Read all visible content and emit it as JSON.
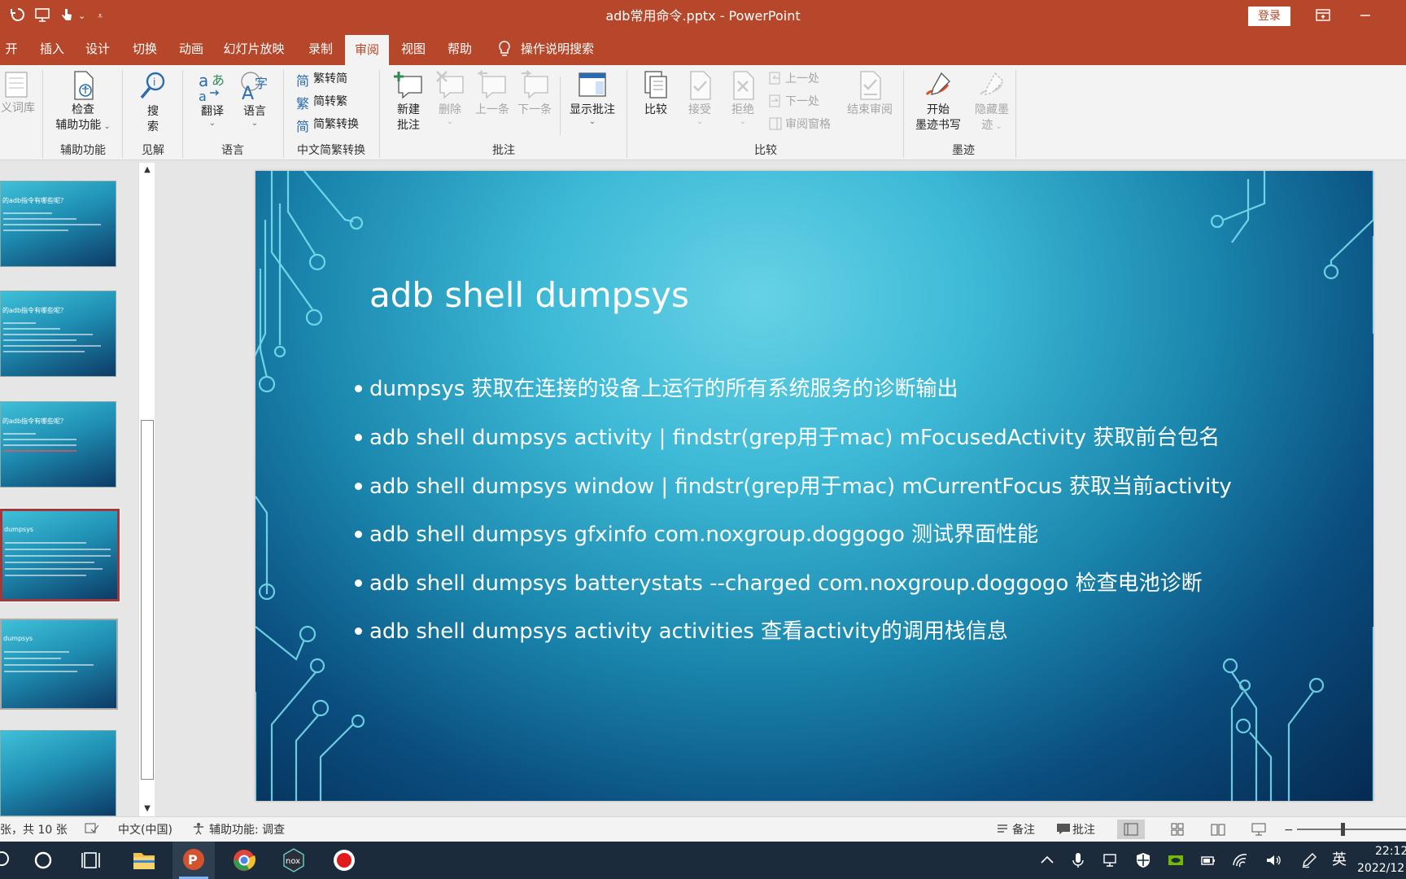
{
  "window": {
    "title": "adb常用命令.pptx  -  PowerPoint",
    "login_label": "登录"
  },
  "tabs": [
    {
      "label": "开始"
    },
    {
      "label": "插入"
    },
    {
      "label": "设计"
    },
    {
      "label": "切换"
    },
    {
      "label": "动画"
    },
    {
      "label": "幻灯片放映"
    },
    {
      "label": "录制"
    },
    {
      "label": "审阅",
      "active": true
    },
    {
      "label": "视图"
    },
    {
      "label": "帮助"
    }
  ],
  "tell_me": {
    "label": "操作说明搜索",
    "icon": "lightbulb-icon"
  },
  "ribbon": {
    "thesaurus_label": "义词库",
    "check_accessibility_line1": "检查",
    "check_accessibility_line2": "辅助功能",
    "group_accessibility": "辅助功能",
    "search_line1": "搜",
    "search_line2": "索",
    "group_insights": "见解",
    "translate_label": "翻译",
    "language_label": "语言",
    "group_language": "语言",
    "trad_to_simp": "繁转简",
    "simp_to_trad": "简转繁",
    "simp_trad_convert": "简繁转换",
    "group_chinese_convert": "中文简繁转换",
    "new_comment_line1": "新建",
    "new_comment_line2": "批注",
    "delete_label": "删除",
    "previous_label": "上一条",
    "next_label": "下一条",
    "show_comments_label": "显示批注",
    "group_comments": "批注",
    "compare_label": "比较",
    "accept_label": "接受",
    "reject_label": "拒绝",
    "prev_change": "上一处",
    "next_change": "下一处",
    "reviewing_pane": "审阅窗格",
    "end_review_label": "结束审阅",
    "group_compare": "比较",
    "start_inking_line1": "开始",
    "start_inking_line2": "墨迹书写",
    "hide_ink_line1": "隐藏墨",
    "hide_ink_line2": "迹",
    "group_ink": "墨迹"
  },
  "thumbnails": [
    {
      "title": "的adb指令有哪些呢？"
    },
    {
      "title": "的adb指令有哪些呢？"
    },
    {
      "title": "的adb指令有哪些呢？"
    },
    {
      "title": "dumpsys",
      "selected": true
    },
    {
      "title": "dumpsys"
    },
    {
      "title": ""
    }
  ],
  "slide": {
    "title": "adb shell dumpsys",
    "bullets": [
      "dumpsys 获取在连接的设备上运行的所有系统服务的诊断输出",
      "adb shell dumpsys activity | findstr(grep用于mac) mFocusedActivity 获取前台包名",
      "adb shell dumpsys window | findstr(grep用于mac) mCurrentFocus 获取当前activity",
      "adb shell dumpsys gfxinfo com.noxgroup.doggogo 测试界面性能",
      "adb shell dumpsys batterystats --charged com.noxgroup.doggogo 检查电池诊断",
      "adb shell dumpsys activity activities 查看activity的调用栈信息"
    ]
  },
  "statusbar": {
    "slide_count": "张，共 10 张",
    "language": "中文(中国)",
    "accessibility": "辅助功能: 调查",
    "notes_label": "备注",
    "comments_label": "批注"
  },
  "taskbar": {
    "ime": "英",
    "time": "22:12",
    "date": "2022/12"
  },
  "colors": {
    "accent": "#b7472a",
    "taskbar": "#1c2b3c"
  }
}
